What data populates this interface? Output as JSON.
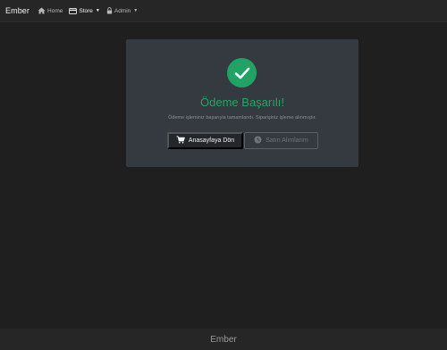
{
  "navbar": {
    "brand": "Ember",
    "items": [
      {
        "label": "Home",
        "icon": "home-icon"
      },
      {
        "label": "Store",
        "icon": "store-icon",
        "dropdown": true
      },
      {
        "label": "Admin",
        "icon": "lock-icon",
        "dropdown": true
      }
    ]
  },
  "card": {
    "status_icon": "check-circle-icon",
    "title": "Ödeme Başarılı!",
    "message": "Ödeme işleminiz başarıyla tamamlandı. Siparişiniz işleme alınmıştır.",
    "home_button": {
      "label": "Anasayfaya Dön",
      "icon": "cart-icon"
    },
    "disabled_button": {
      "label": "Satın Alımlarım",
      "icon": "clock-icon"
    }
  },
  "footer": {
    "text": "Ember"
  },
  "colors": {
    "success": "#21a366",
    "card_bg": "#343a40",
    "page_bg": "#1f1f1f",
    "navbar_bg": "#262626"
  }
}
